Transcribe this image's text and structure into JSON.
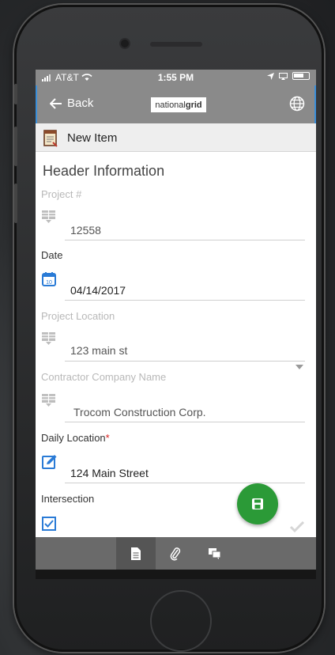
{
  "status_bar": {
    "carrier": "AT&T",
    "time": "1:55 PM"
  },
  "nav": {
    "back_label": "Back",
    "logo_light": "national",
    "logo_bold": "grid",
    "icons": {
      "back": "arrow-left-icon",
      "globe": "globe-icon"
    }
  },
  "title_bar": {
    "title": "New Item",
    "icon": "document-icon"
  },
  "form": {
    "section_title": "Header Information",
    "fields": [
      {
        "label": "Project #",
        "value": "12558",
        "icon": "list-icon"
      },
      {
        "label": "Date",
        "value": "04/14/2017",
        "icon": "calendar-icon"
      },
      {
        "label": "Project Location",
        "value": "123 main st",
        "icon": "list-icon"
      },
      {
        "label": "Contractor Company Name",
        "value": "Trocom Construction Corp.",
        "icon": "list-icon"
      },
      {
        "label": "Daily Location",
        "value": "124 Main Street",
        "icon": "edit-icon",
        "required_mark": "*"
      },
      {
        "label": "Intersection",
        "icon": "checkbox-icon"
      }
    ],
    "calendar_day": "10"
  },
  "fab": {
    "icon": "save-icon"
  },
  "tabbar": {
    "tabs": [
      {
        "icon": "document-icon",
        "active": true
      },
      {
        "icon": "paperclip-icon",
        "active": false
      },
      {
        "icon": "comments-icon",
        "active": false
      }
    ]
  },
  "colors": {
    "nav_background": "#8a8a8a",
    "accent_blue": "#3b8fd9",
    "fab_green": "#2b9a37",
    "required_red": "#d9201e",
    "tabbar_background": "#6a6a6a"
  }
}
